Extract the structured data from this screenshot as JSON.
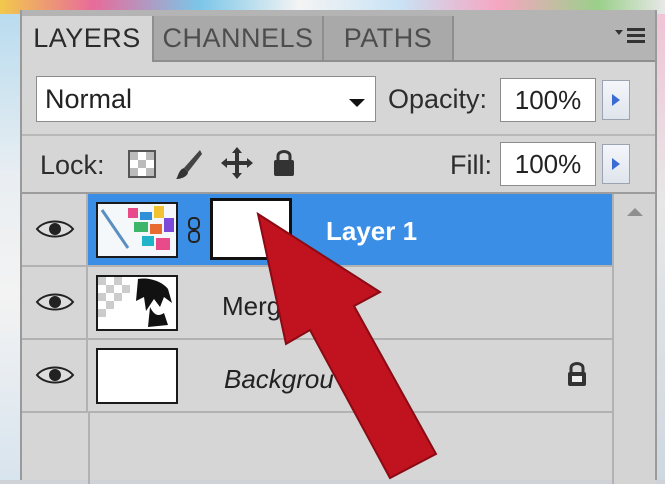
{
  "tabs": [
    {
      "label": "LAYERS",
      "active": true
    },
    {
      "label": "CHANNELS",
      "active": false
    },
    {
      "label": "PATHS",
      "active": false
    }
  ],
  "panel_menu_icon": "panel-menu-icon",
  "blend": {
    "mode": "Normal",
    "opacity_label": "Opacity:",
    "opacity_value": "100%"
  },
  "lock": {
    "label": "Lock:",
    "icons": [
      "lock-transparent-pixels-icon",
      "lock-image-pixels-icon",
      "lock-position-icon",
      "lock-all-icon"
    ],
    "fill_label": "Fill:",
    "fill_value": "100%"
  },
  "layers": [
    {
      "name": "Layer 1",
      "selected": true,
      "has_mask": true,
      "italic": false,
      "locked": false
    },
    {
      "name": "Merge",
      "selected": false,
      "has_mask": false,
      "italic": false,
      "locked": false
    },
    {
      "name": "Backgrou",
      "selected": false,
      "has_mask": false,
      "italic": true,
      "locked": true
    }
  ],
  "colors": {
    "selection": "#3a8ee6",
    "annotation_arrow": "#c1121f",
    "panel": "#d6d6d6"
  }
}
